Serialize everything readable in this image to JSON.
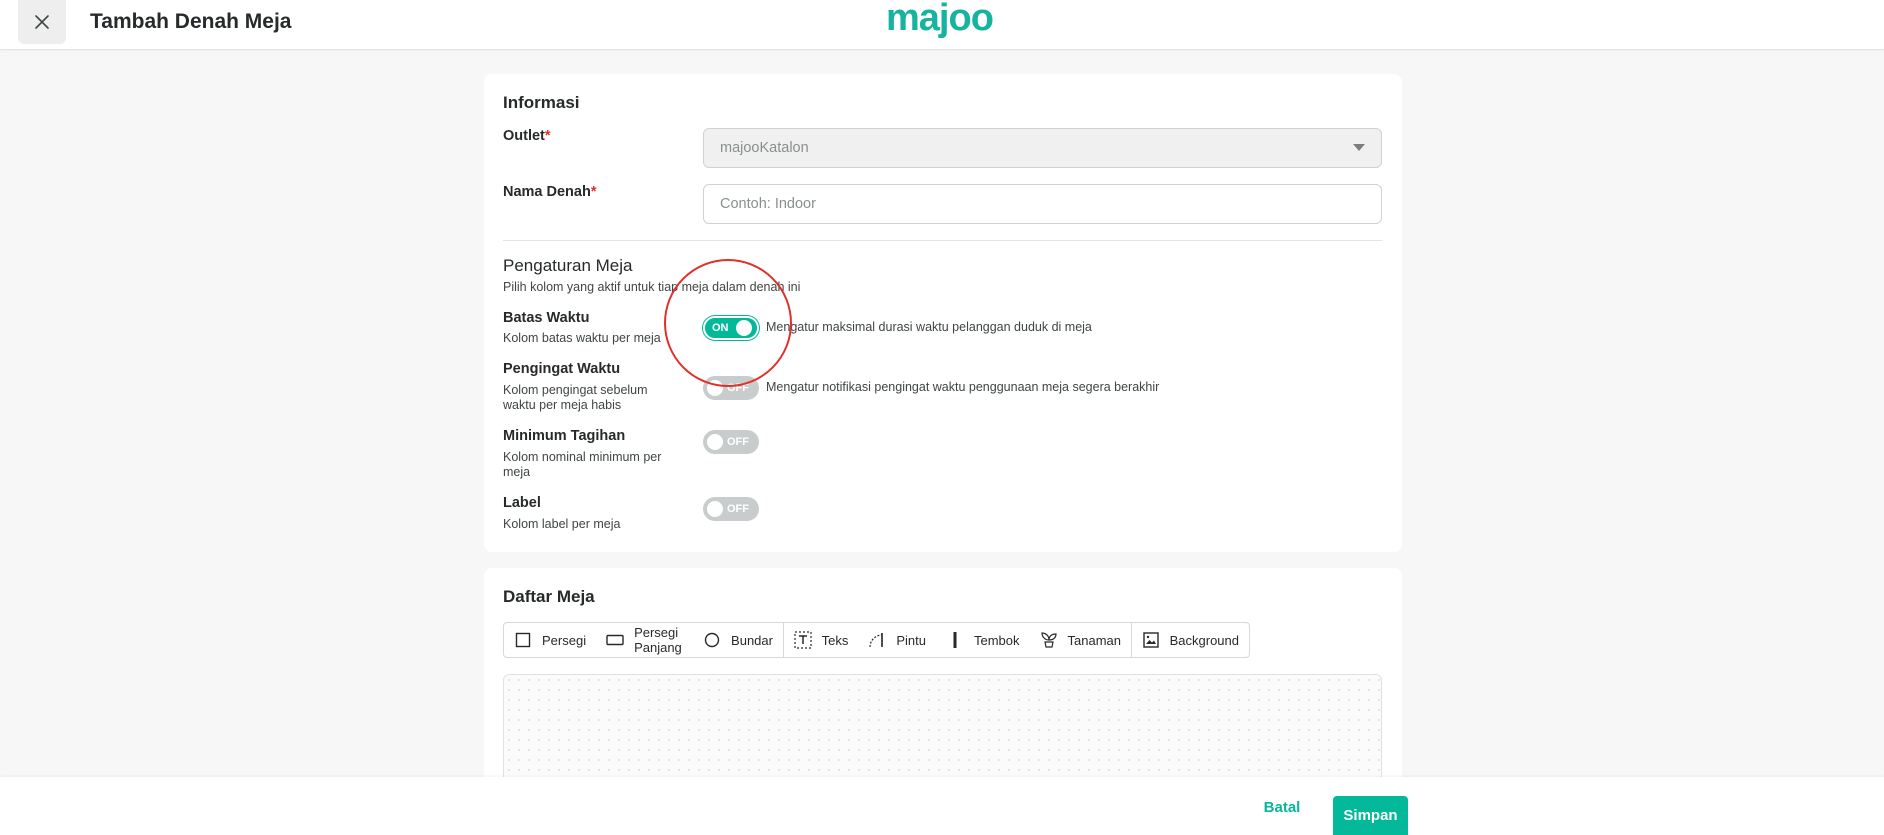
{
  "header": {
    "title": "Tambah Denah Meja",
    "logo_text": "majoo",
    "close_icon": "close-icon"
  },
  "informasi": {
    "title": "Informasi",
    "outlet_label": "Outlet",
    "outlet_value": "majooKatalon",
    "nama_label": "Nama Denah",
    "nama_placeholder": "Contoh: Indoor",
    "required_mark": "*"
  },
  "pengaturan": {
    "title": "Pengaturan Meja",
    "subtitle": "Pilih kolom yang aktif untuk tiap meja dalam denah ini",
    "rows": [
      {
        "label": "Batas Waktu",
        "desc": "Kolom batas waktu per meja",
        "state": "ON",
        "info": "Mengatur maksimal durasi waktu pelanggan duduk di meja"
      },
      {
        "label": "Pengingat Waktu",
        "desc": "Kolom pengingat sebelum waktu per meja habis",
        "state": "OFF",
        "info": "Mengatur notifikasi pengingat waktu penggunaan meja segera berakhir"
      },
      {
        "label": "Minimum Tagihan",
        "desc": "Kolom nominal minimum per meja",
        "state": "OFF",
        "info": ""
      },
      {
        "label": "Label",
        "desc": "Kolom label per meja",
        "state": "OFF",
        "info": ""
      }
    ]
  },
  "daftar": {
    "title": "Daftar Meja",
    "tools": [
      {
        "label": "Persegi",
        "icon": "square-icon"
      },
      {
        "label": "Persegi Panjang",
        "icon": "rectangle-icon"
      },
      {
        "label": "Bundar",
        "icon": "circle-icon"
      },
      {
        "label": "Teks",
        "icon": "text-icon"
      },
      {
        "label": "Pintu",
        "icon": "door-icon"
      },
      {
        "label": "Tembok",
        "icon": "wall-icon"
      },
      {
        "label": "Tanaman",
        "icon": "plant-icon"
      },
      {
        "label": "Background",
        "icon": "image-icon"
      }
    ]
  },
  "footer": {
    "cancel_label": "Batal",
    "save_label": "Simpan"
  },
  "colors": {
    "accent": "#03b99a",
    "required": "#e0302c",
    "annotation": "#e0302c"
  }
}
